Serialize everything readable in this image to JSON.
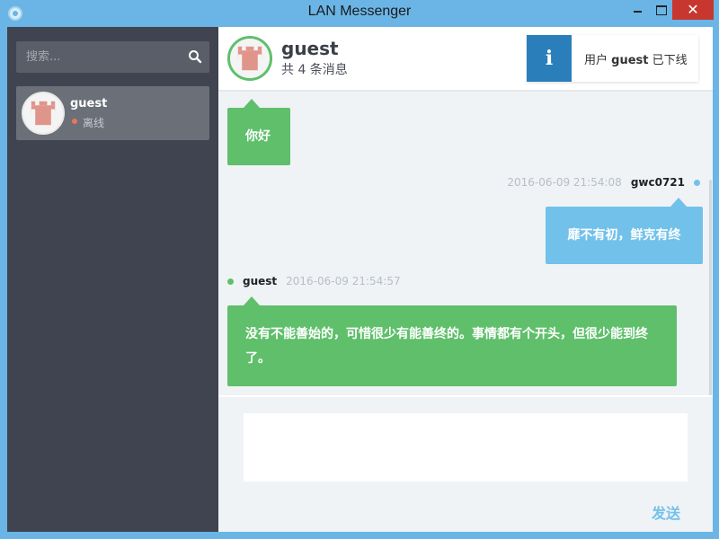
{
  "window": {
    "title": "LAN Messenger",
    "close_glyph": "✕",
    "icons": [
      "app-icon",
      "minimize-icon",
      "maximize-icon",
      "close-icon"
    ]
  },
  "sidebar": {
    "search": {
      "placeholder": "搜索...",
      "value": "",
      "icon": "search-icon"
    },
    "contacts": [
      {
        "name": "guest",
        "status": "离线",
        "status_color": "#e8765c",
        "avatar": "pixel-avatar"
      }
    ]
  },
  "chat": {
    "header": {
      "name": "guest",
      "message_count": "共 4 条消息"
    },
    "notice": {
      "icon_label": "i",
      "text_prefix": "用户 ",
      "text_user": "guest",
      "text_suffix": " 已下线"
    },
    "messages": [
      {
        "text": "你好"
      },
      {
        "time": "2016-06-09 21:54:08",
        "sender": "gwc0721",
        "text": "靡不有初，鲜克有终"
      },
      {
        "time": "2016-06-09 21:54:57",
        "sender": "guest",
        "text": "没有不能善始的，可惜很少有能善终的。事情都有个开头，但很少能到终了。"
      }
    ],
    "composer": {
      "value": "",
      "send_label": "发送"
    }
  },
  "colors": {
    "titlebar": "#6ab5e6",
    "sidebar": "#3f4450",
    "green": "#5fbf6b",
    "blue": "#72c1eb",
    "notice_icon": "#2a7fba",
    "close": "#c7372f"
  }
}
